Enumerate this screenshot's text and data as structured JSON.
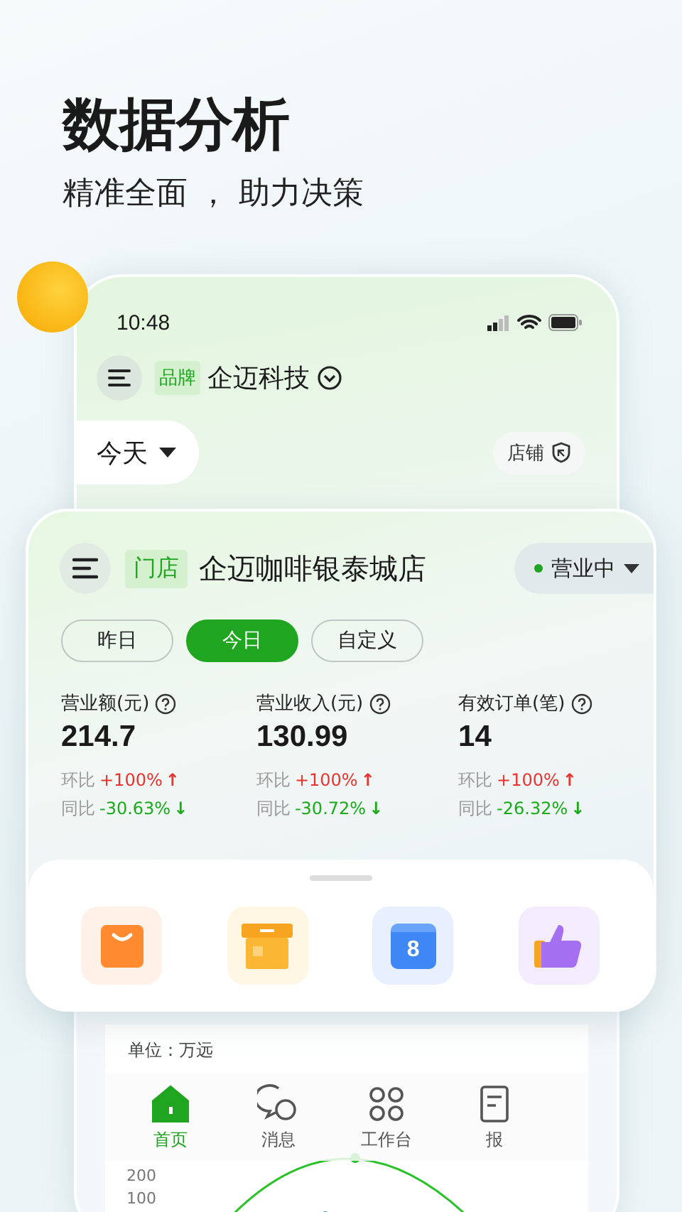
{
  "headline": {
    "title": "数据分析",
    "subtitle": "精准全面 ， 助力决策"
  },
  "phone": {
    "status_bar": {
      "time": "10:48"
    },
    "brand": {
      "tag": "品牌",
      "name": "企迈科技"
    },
    "date_picker": {
      "value": "今天"
    },
    "store_button": {
      "label": "店铺"
    },
    "chart_panel": {
      "unit": "单位：万远",
      "yticks": [
        "200",
        "100"
      ]
    },
    "tab_bar": [
      {
        "label": "首页",
        "kind": "home",
        "selected": true
      },
      {
        "label": "消息",
        "kind": "chat",
        "selected": false
      },
      {
        "label": "工作台",
        "kind": "grid",
        "selected": false
      },
      {
        "label": "报",
        "kind": "report",
        "selected": false
      }
    ]
  },
  "store_card": {
    "tag": "门店",
    "name": "企迈咖啡银泰城店",
    "status": {
      "label": "营业中",
      "open": true
    },
    "periods": [
      {
        "label": "昨日",
        "selected": false
      },
      {
        "label": "今日",
        "selected": true
      },
      {
        "label": "自定义",
        "selected": false
      }
    ],
    "metrics": [
      {
        "label": "营业额(元)",
        "value": "214.7",
        "comparisons": [
          {
            "label": "环比",
            "value": "+100%",
            "arrow": "↑",
            "kind": "up"
          },
          {
            "label": "同比",
            "value": "-30.63%",
            "arrow": "↓",
            "kind": "down"
          }
        ]
      },
      {
        "label": "营业收入(元)",
        "value": "130.99",
        "comparisons": [
          {
            "label": "环比",
            "value": "+100%",
            "arrow": "↑",
            "kind": "up"
          },
          {
            "label": "同比",
            "value": "-30.72%",
            "arrow": "↓",
            "kind": "down"
          }
        ]
      },
      {
        "label": "有效订单(笔)",
        "value": "14",
        "comparisons": [
          {
            "label": "环比",
            "value": "+100%",
            "arrow": "↑",
            "kind": "up"
          },
          {
            "label": "同比",
            "value": "-26.32%",
            "arrow": "↓",
            "kind": "down"
          }
        ]
      }
    ],
    "tools": [
      {
        "kind": "bag"
      },
      {
        "kind": "box"
      },
      {
        "kind": "ticket",
        "text": "8"
      },
      {
        "kind": "thumb"
      }
    ]
  }
}
